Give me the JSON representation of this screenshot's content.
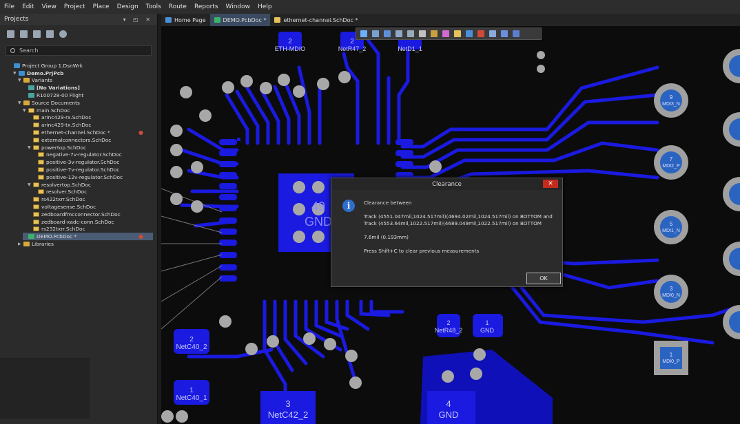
{
  "menu": [
    "File",
    "Edit",
    "View",
    "Project",
    "Place",
    "Design",
    "Tools",
    "Route",
    "Reports",
    "Window",
    "Help"
  ],
  "panel": {
    "title": "Projects",
    "search_placeholder": "Search",
    "tree": [
      {
        "label": "Project Group 1.DsnWrk",
        "indent": 0,
        "icon": "proj",
        "arrow": ""
      },
      {
        "label": "Demo.PrjPcb",
        "indent": 1,
        "icon": "proj",
        "arrow": "▼",
        "bold": true
      },
      {
        "label": "Variants",
        "indent": 2,
        "icon": "folder",
        "arrow": "▼"
      },
      {
        "label": "[No Variations]",
        "indent": 3,
        "icon": "var",
        "arrow": "",
        "bold": true
      },
      {
        "label": "R100728-00 Flight",
        "indent": 3,
        "icon": "var",
        "arrow": ""
      },
      {
        "label": "Source Documents",
        "indent": 2,
        "icon": "folder",
        "arrow": "▼"
      },
      {
        "label": "main.SchDoc",
        "indent": 3,
        "icon": "doc",
        "arrow": "▼"
      },
      {
        "label": "arinc429-rx.SchDoc",
        "indent": 4,
        "icon": "doc",
        "arrow": ""
      },
      {
        "label": "arinc429-tx.SchDoc",
        "indent": 4,
        "icon": "doc",
        "arrow": ""
      },
      {
        "label": "ethernet-channel.SchDoc *",
        "indent": 4,
        "icon": "doc",
        "arrow": "",
        "modified": true
      },
      {
        "label": "externalconnectors.SchDoc",
        "indent": 4,
        "icon": "doc",
        "arrow": ""
      },
      {
        "label": "powertop.SchDoc",
        "indent": 4,
        "icon": "doc",
        "arrow": "▼"
      },
      {
        "label": "negative-7v-regulator.SchDoc",
        "indent": 5,
        "icon": "doc",
        "arrow": ""
      },
      {
        "label": "positive-3v-regulator.SchDoc",
        "indent": 5,
        "icon": "doc",
        "arrow": ""
      },
      {
        "label": "positive-7v-regulator.SchDoc",
        "indent": 5,
        "icon": "doc",
        "arrow": ""
      },
      {
        "label": "positive-12v-regulator.SchDoc",
        "indent": 5,
        "icon": "doc",
        "arrow": ""
      },
      {
        "label": "resolvertop.SchDoc",
        "indent": 4,
        "icon": "doc",
        "arrow": "▼"
      },
      {
        "label": "resolver.SchDoc",
        "indent": 5,
        "icon": "doc",
        "arrow": ""
      },
      {
        "label": "rs422txrr.SchDoc",
        "indent": 4,
        "icon": "doc",
        "arrow": ""
      },
      {
        "label": "voltagesense.SchDoc",
        "indent": 4,
        "icon": "doc",
        "arrow": ""
      },
      {
        "label": "zedboardfmcconnector.SchDoc",
        "indent": 4,
        "icon": "doc",
        "arrow": ""
      },
      {
        "label": "zedboard-xadc-conn.SchDoc",
        "indent": 4,
        "icon": "doc",
        "arrow": ""
      },
      {
        "label": "rs232txrr.SchDoc",
        "indent": 4,
        "icon": "doc",
        "arrow": ""
      },
      {
        "label": "DEMO.PcbDoc *",
        "indent": 3,
        "icon": "pcb",
        "arrow": "",
        "selected": true,
        "modified": true
      },
      {
        "label": "Libraries",
        "indent": 2,
        "icon": "folder",
        "arrow": "▶"
      }
    ]
  },
  "tabs": [
    {
      "label": "Home Page",
      "icon": "#4a90d9"
    },
    {
      "label": "DEMO.PcbDoc *",
      "icon": "#3bb36a",
      "active": true
    },
    {
      "label": "ethernet-channel.SchDoc *",
      "icon": "#e6c15c"
    }
  ],
  "pcb_labels": {
    "eth_mdio_num": "2",
    "eth_mdio": "ETH-MDIO",
    "netr47_num": "2",
    "netr47": "NetR47_2",
    "netd1": "NetD1_1",
    "gnd49_num": "49",
    "gnd49": "GND",
    "netc40_2_num": "2",
    "netc40_2": "NetC40_2",
    "netc40_1_num": "1",
    "netc40_1": "NetC40_1",
    "netc42_num": "3",
    "netc42": "NetC42_2",
    "netr48_num": "2",
    "netr48": "NetR48_2",
    "gnd1_num": "1",
    "gnd1": "GND",
    "gnd4_num": "4",
    "gnd4": "GND",
    "mdi_9_num": "9",
    "mdi_9": "MDI3_N",
    "mdi_7_num": "7",
    "mdi_7": "MDI2_P",
    "mdi_5_num": "5",
    "mdi_5": "MDI1_N",
    "mdi_3_num": "3",
    "mdi_3": "MDI0_N",
    "mdi_1_num": "1",
    "mdi_1": "MDI0_P"
  },
  "dialog": {
    "title": "Clearance",
    "close": "✕",
    "info_icon": "i",
    "line1": "Clearance between",
    "line2": "Track (4551.047mil,1024.517mil)(4694.02mil,1024.517mil) on BOTTOM and",
    "line3": "Track (4553.64mil,1022.517mil)(4689.049mil,1022.517mil) on BOTTOM",
    "line4": "7.6mil (0.193mm)",
    "line5": "Press Shift+C to clear previous measurements",
    "ok": "OK"
  }
}
